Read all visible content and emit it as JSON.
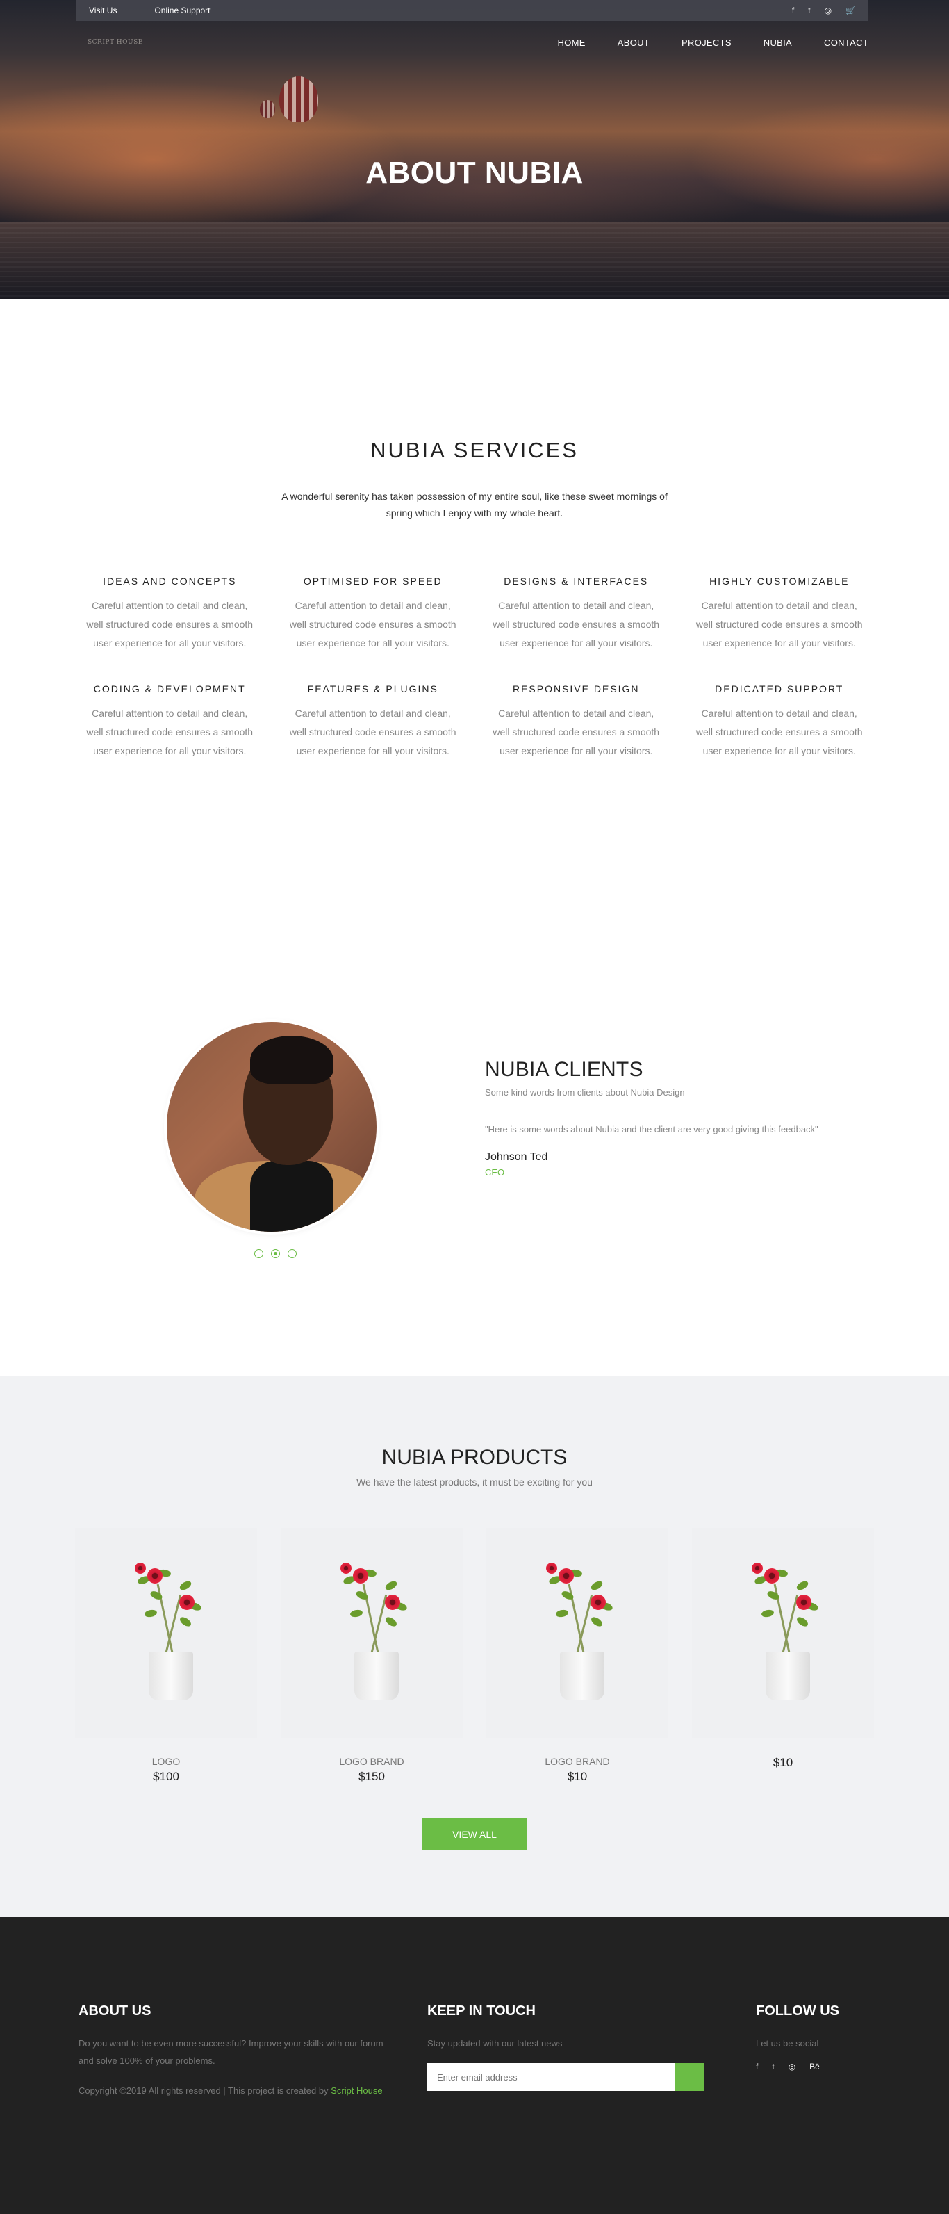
{
  "topbar": {
    "visit": "Visit Us",
    "support": "Online Support",
    "icons": [
      "f",
      "t",
      "◎",
      "🛒"
    ]
  },
  "brand": {
    "logo": "SCRIPT HOUSE"
  },
  "nav": [
    "HOME",
    "ABOUT",
    "PROJECTS",
    "NUBIA",
    "CONTACT"
  ],
  "hero": {
    "title": "ABOUT NUBIA"
  },
  "services": {
    "title": "NUBIA SERVICES",
    "lead": "A wonderful serenity has taken possession of my entire soul, like these sweet mornings of spring which I enjoy with my whole heart.",
    "items": [
      {
        "title": "IDEAS AND CONCEPTS",
        "text": "Careful attention to detail and clean, well structured code ensures a smooth user experience for all your visitors."
      },
      {
        "title": "OPTIMISED FOR SPEED",
        "text": "Careful attention to detail and clean, well structured code ensures a smooth user experience for all your visitors."
      },
      {
        "title": "DESIGNS & INTERFACES",
        "text": "Careful attention to detail and clean, well structured code ensures a smooth user experience for all your visitors."
      },
      {
        "title": "HIGHLY CUSTOMIZABLE",
        "text": "Careful attention to detail and clean, well structured code ensures a smooth user experience for all your visitors."
      },
      {
        "title": "CODING & DEVELOPMENT",
        "text": "Careful attention to detail and clean, well structured code ensures a smooth user experience for all your visitors."
      },
      {
        "title": "FEATURES & PLUGINS",
        "text": "Careful attention to detail and clean, well structured code ensures a smooth user experience for all your visitors."
      },
      {
        "title": "RESPONSIVE DESIGN",
        "text": "Careful attention to detail and clean, well structured code ensures a smooth user experience for all your visitors."
      },
      {
        "title": "DEDICATED SUPPORT",
        "text": "Careful attention to detail and clean, well structured code ensures a smooth user experience for all your visitors."
      }
    ]
  },
  "clients": {
    "title": "NUBIA CLIENTS",
    "subtitle": "Some kind words from clients about Nubia Design",
    "quote": "\"Here is some words about Nubia and the client are very good giving this feedback\"",
    "name": "Johnson Ted",
    "role": "CEO",
    "active_slide": 2
  },
  "products": {
    "title": "NUBIA PRODUCTS",
    "subtitle": "We have the latest products, it must be exciting for you",
    "items": [
      {
        "name": "LOGO",
        "price": "$100"
      },
      {
        "name": "LOGO BRAND",
        "price": "$150"
      },
      {
        "name": "LOGO BRAND",
        "price": "$10"
      },
      {
        "name": "",
        "price": "$10"
      }
    ],
    "view_all": "VIEW ALL"
  },
  "footer": {
    "about_title": "ABOUT US",
    "about_text": "Do you want to be even more successful? Improve your skills with our forum and solve 100% of your problems.",
    "copyright": "Copyright ©2019 All rights reserved | This project is created by",
    "copyright_link": "Script House",
    "keep_title": "KEEP IN TOUCH",
    "keep_text": "Stay updated with our latest news",
    "email_placeholder": "Enter email address",
    "follow_title": "FOLLOW US",
    "follow_text": "Let us be social",
    "social": [
      "f",
      "t",
      "◎",
      "Bē"
    ]
  },
  "colors": {
    "accent": "#6bbd45",
    "footer_bg": "#222222",
    "products_bg": "#f1f2f4"
  }
}
